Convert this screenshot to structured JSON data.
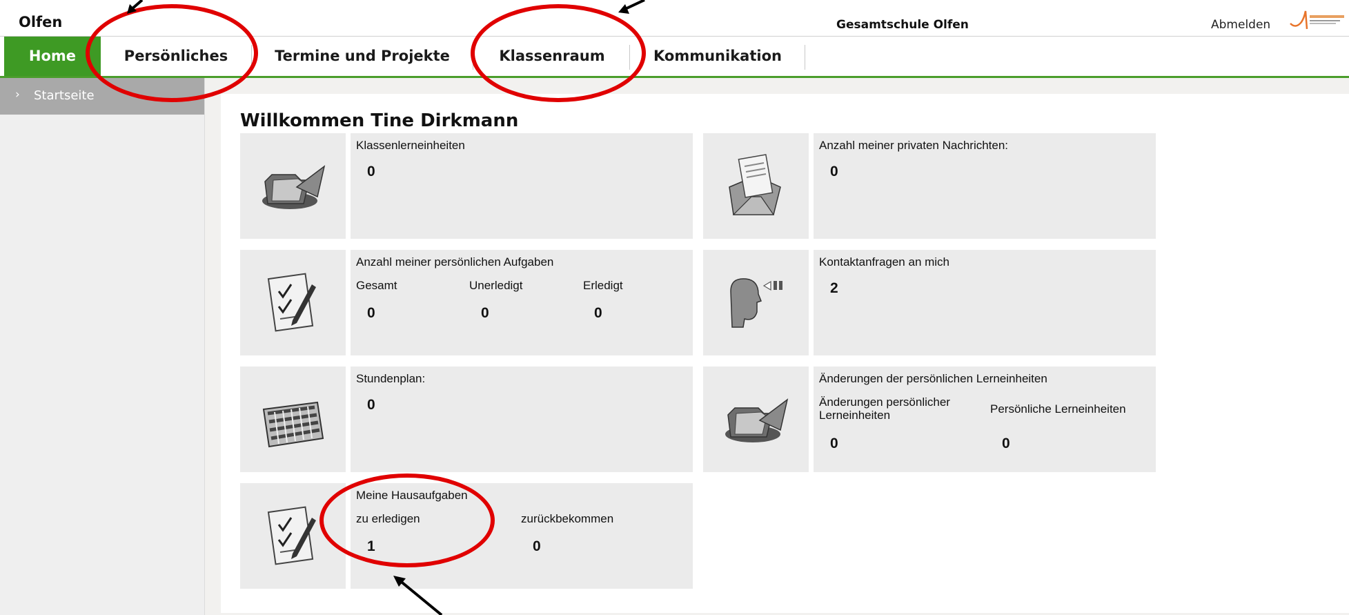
{
  "header": {
    "site_name": "Olfen",
    "school_name": "Gesamtschule Olfen",
    "logout_label": "Abmelden"
  },
  "nav": {
    "items": [
      {
        "label": "Home",
        "active": true
      },
      {
        "label": "Persönliches",
        "active": false
      },
      {
        "label": "Termine und Projekte",
        "active": false
      },
      {
        "label": "Klassenraum",
        "active": false
      },
      {
        "label": "Kommunikation",
        "active": false
      }
    ]
  },
  "sidebar": {
    "items": [
      {
        "label": "Startseite"
      }
    ]
  },
  "main": {
    "welcome": "Willkommen Tine Dirkmann",
    "tiles": {
      "klassen": {
        "title": "Klassenlerneinheiten",
        "value": "0",
        "icon": "folder-arrow-icon"
      },
      "nachrichten": {
        "title": "Anzahl meiner privaten Nachrichten:",
        "value": "0",
        "icon": "envelope-letter-icon"
      },
      "aufgaben": {
        "title": "Anzahl meiner persönlichen Aufgaben",
        "icon": "checklist-pen-icon",
        "columns": [
          {
            "label": "Gesamt",
            "value": "0"
          },
          {
            "label": "Unerledigt",
            "value": "0"
          },
          {
            "label": "Erledigt",
            "value": "0"
          }
        ]
      },
      "kontakt": {
        "title": "Kontaktanfragen an mich",
        "value": "2",
        "icon": "speaking-head-icon"
      },
      "stundenplan": {
        "title": "Stundenplan:",
        "value": "0",
        "icon": "calendar-grid-icon"
      },
      "aenderungen": {
        "title": "Änderungen der persönlichen Lerneinheiten",
        "icon": "folder-arrow-icon",
        "col1_label_line1": "Änderungen persönlicher",
        "col1_label_line2": "Lerneinheiten",
        "col1_value": "0",
        "col2_label": "Persönliche Lerneinheiten",
        "col2_value": "0"
      },
      "hausaufgaben": {
        "title": "Meine Hausaufgaben",
        "icon": "checklist-pen-icon",
        "columns": [
          {
            "label": "zu erledigen",
            "value": "1"
          },
          {
            "label": "zurückbekommen",
            "value": "0"
          }
        ]
      }
    }
  },
  "colors": {
    "nav_active": "#3e9a24",
    "nav_underline": "#4a9d2b",
    "annotation_red": "#e00000",
    "tile_bg": "#ebebeb"
  }
}
